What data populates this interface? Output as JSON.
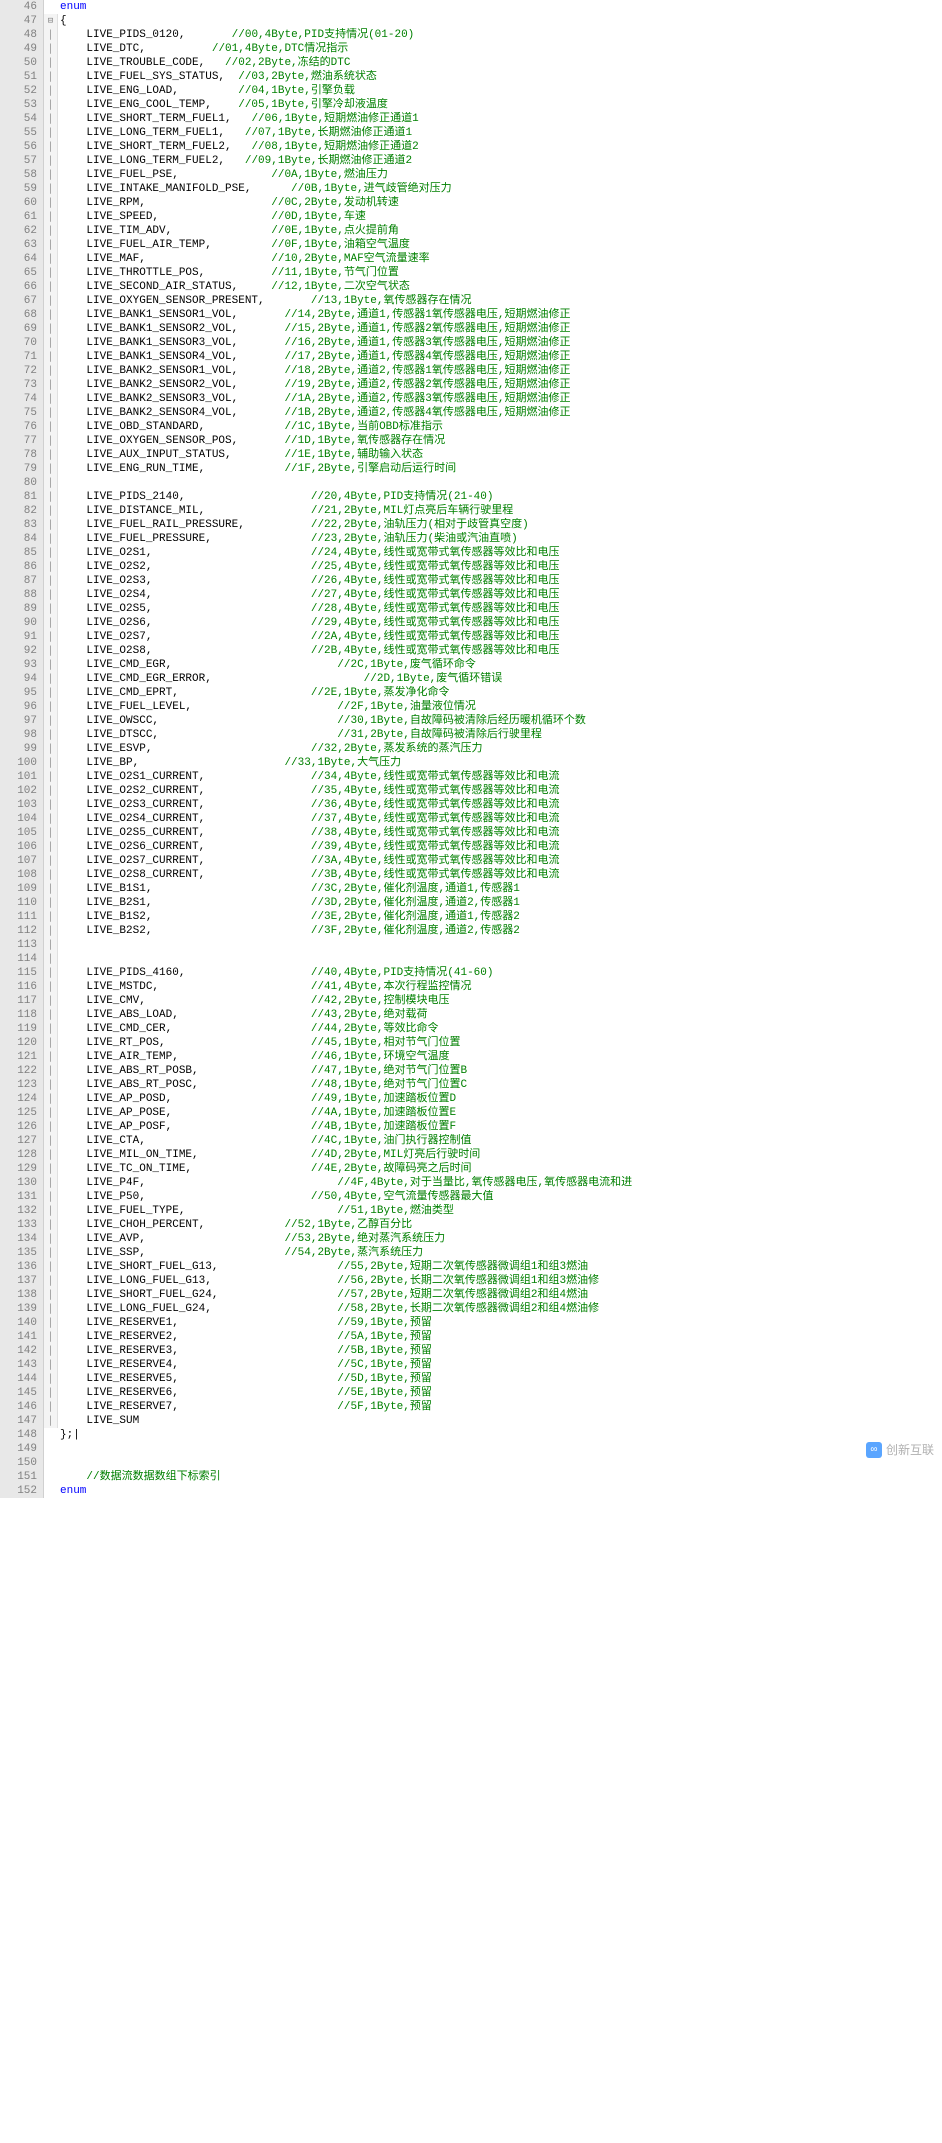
{
  "watermark": "创新互联",
  "bottom_comment": "//数据流数据数组下标索引",
  "lines": [
    {
      "n": 46,
      "fold": "",
      "type": "kw",
      "text": "enum"
    },
    {
      "n": 47,
      "fold": "⊟",
      "type": "punct",
      "text": "{"
    },
    {
      "n": 48,
      "fold": "|",
      "indent": "    ",
      "ident": "LIVE_PIDS_0120,",
      "pad": 7,
      "comment": "//00,4Byte,PID支持情况(01-20)"
    },
    {
      "n": 49,
      "fold": "|",
      "indent": "    ",
      "ident": "LIVE_DTC,",
      "pad": 10,
      "comment": "//01,4Byte,DTC情况指示"
    },
    {
      "n": 50,
      "fold": "|",
      "indent": "    ",
      "ident": "LIVE_TROUBLE_CODE,",
      "pad": 3,
      "comment": "//02,2Byte,冻结的DTC"
    },
    {
      "n": 51,
      "fold": "|",
      "indent": "    ",
      "ident": "LIVE_FUEL_SYS_STATUS,",
      "pad": 2,
      "comment": "//03,2Byte,燃油系统状态"
    },
    {
      "n": 52,
      "fold": "|",
      "indent": "    ",
      "ident": "LIVE_ENG_LOAD,",
      "pad": 9,
      "comment": "//04,1Byte,引擎负载"
    },
    {
      "n": 53,
      "fold": "|",
      "indent": "    ",
      "ident": "LIVE_ENG_COOL_TEMP,",
      "pad": 4,
      "comment": "//05,1Byte,引擎冷却液温度"
    },
    {
      "n": 54,
      "fold": "|",
      "indent": "    ",
      "ident": "LIVE_SHORT_TERM_FUEL1,",
      "pad": 3,
      "comment": "//06,1Byte,短期燃油修正通道1"
    },
    {
      "n": 55,
      "fold": "|",
      "indent": "    ",
      "ident": "LIVE_LONG_TERM_FUEL1,",
      "pad": 3,
      "comment": "//07,1Byte,长期燃油修正通道1"
    },
    {
      "n": 56,
      "fold": "|",
      "indent": "    ",
      "ident": "LIVE_SHORT_TERM_FUEL2,",
      "pad": 3,
      "comment": "//08,1Byte,短期燃油修正通道2"
    },
    {
      "n": 57,
      "fold": "|",
      "indent": "    ",
      "ident": "LIVE_LONG_TERM_FUEL2,",
      "pad": 3,
      "comment": "//09,1Byte,长期燃油修正通道2"
    },
    {
      "n": 58,
      "fold": "|",
      "indent": "    ",
      "ident": "LIVE_FUEL_PSE,",
      "pad": 14,
      "comment": "//0A,1Byte,燃油压力"
    },
    {
      "n": 59,
      "fold": "|",
      "indent": "    ",
      "ident": "LIVE_INTAKE_MANIFOLD_PSE,",
      "pad": 6,
      "comment": "//0B,1Byte,进气歧管绝对压力"
    },
    {
      "n": 60,
      "fold": "|",
      "indent": "    ",
      "ident": "LIVE_RPM,",
      "pad": 19,
      "comment": "//0C,2Byte,发动机转速"
    },
    {
      "n": 61,
      "fold": "|",
      "indent": "    ",
      "ident": "LIVE_SPEED,",
      "pad": 17,
      "comment": "//0D,1Byte,车速"
    },
    {
      "n": 62,
      "fold": "|",
      "indent": "    ",
      "ident": "LIVE_TIM_ADV,",
      "pad": 15,
      "comment": "//0E,1Byte,点火提前角"
    },
    {
      "n": 63,
      "fold": "|",
      "indent": "    ",
      "ident": "LIVE_FUEL_AIR_TEMP,",
      "pad": 9,
      "comment": "//0F,1Byte,油箱空气温度"
    },
    {
      "n": 64,
      "fold": "|",
      "indent": "    ",
      "ident": "LIVE_MAF,",
      "pad": 19,
      "comment": "//10,2Byte,MAF空气流量速率"
    },
    {
      "n": 65,
      "fold": "|",
      "indent": "    ",
      "ident": "LIVE_THROTTLE_POS,",
      "pad": 10,
      "comment": "//11,1Byte,节气门位置"
    },
    {
      "n": 66,
      "fold": "|",
      "indent": "    ",
      "ident": "LIVE_SECOND_AIR_STATUS,",
      "pad": 5,
      "comment": "//12,1Byte,二次空气状态"
    },
    {
      "n": 67,
      "fold": "|",
      "indent": "    ",
      "ident": "LIVE_OXYGEN_SENSOR_PRESENT,",
      "pad": 7,
      "comment": "//13,1Byte,氧传感器存在情况"
    },
    {
      "n": 68,
      "fold": "|",
      "indent": "    ",
      "ident": "LIVE_BANK1_SENSOR1_VOL,",
      "pad": 7,
      "comment": "//14,2Byte,通道1,传感器1氧传感器电压,短期燃油修正"
    },
    {
      "n": 69,
      "fold": "|",
      "indent": "    ",
      "ident": "LIVE_BANK1_SENSOR2_VOL,",
      "pad": 7,
      "comment": "//15,2Byte,通道1,传感器2氧传感器电压,短期燃油修正"
    },
    {
      "n": 70,
      "fold": "|",
      "indent": "    ",
      "ident": "LIVE_BANK1_SENSOR3_VOL,",
      "pad": 7,
      "comment": "//16,2Byte,通道1,传感器3氧传感器电压,短期燃油修正"
    },
    {
      "n": 71,
      "fold": "|",
      "indent": "    ",
      "ident": "LIVE_BANK1_SENSOR4_VOL,",
      "pad": 7,
      "comment": "//17,2Byte,通道1,传感器4氧传感器电压,短期燃油修正"
    },
    {
      "n": 72,
      "fold": "|",
      "indent": "    ",
      "ident": "LIVE_BANK2_SENSOR1_VOL,",
      "pad": 7,
      "comment": "//18,2Byte,通道2,传感器1氧传感器电压,短期燃油修正"
    },
    {
      "n": 73,
      "fold": "|",
      "indent": "    ",
      "ident": "LIVE_BANK2_SENSOR2_VOL,",
      "pad": 7,
      "comment": "//19,2Byte,通道2,传感器2氧传感器电压,短期燃油修正"
    },
    {
      "n": 74,
      "fold": "|",
      "indent": "    ",
      "ident": "LIVE_BANK2_SENSOR3_VOL,",
      "pad": 7,
      "comment": "//1A,2Byte,通道2,传感器3氧传感器电压,短期燃油修正"
    },
    {
      "n": 75,
      "fold": "|",
      "indent": "    ",
      "ident": "LIVE_BANK2_SENSOR4_VOL,",
      "pad": 7,
      "comment": "//1B,2Byte,通道2,传感器4氧传感器电压,短期燃油修正"
    },
    {
      "n": 76,
      "fold": "|",
      "indent": "    ",
      "ident": "LIVE_OBD_STANDARD,",
      "pad": 12,
      "comment": "//1C,1Byte,当前OBD标准指示"
    },
    {
      "n": 77,
      "fold": "|",
      "indent": "    ",
      "ident": "LIVE_OXYGEN_SENSOR_POS,",
      "pad": 7,
      "comment": "//1D,1Byte,氧传感器存在情况"
    },
    {
      "n": 78,
      "fold": "|",
      "indent": "    ",
      "ident": "LIVE_AUX_INPUT_STATUS,",
      "pad": 8,
      "comment": "//1E,1Byte,辅助输入状态"
    },
    {
      "n": 79,
      "fold": "|",
      "indent": "    ",
      "ident": "LIVE_ENG_RUN_TIME,",
      "pad": 12,
      "comment": "//1F,2Byte,引擎启动后运行时间"
    },
    {
      "n": 80,
      "fold": "|",
      "indent": "",
      "ident": "",
      "pad": 0,
      "comment": ""
    },
    {
      "n": 81,
      "fold": "|",
      "indent": "    ",
      "ident": "LIVE_PIDS_2140,",
      "pad": 19,
      "comment": "//20,4Byte,PID支持情况(21-40)"
    },
    {
      "n": 82,
      "fold": "|",
      "indent": "    ",
      "ident": "LIVE_DISTANCE_MIL,",
      "pad": 16,
      "comment": "//21,2Byte,MIL灯点亮后车辆行驶里程"
    },
    {
      "n": 83,
      "fold": "|",
      "indent": "    ",
      "ident": "LIVE_FUEL_RAIL_PRESSURE,",
      "pad": 10,
      "comment": "//22,2Byte,油轨压力(相对于歧管真空度)"
    },
    {
      "n": 84,
      "fold": "|",
      "indent": "    ",
      "ident": "LIVE_FUEL_PRESSURE,",
      "pad": 15,
      "comment": "//23,2Byte,油轨压力(柴油或汽油直喷)"
    },
    {
      "n": 85,
      "fold": "|",
      "indent": "    ",
      "ident": "LIVE_O2S1,",
      "pad": 24,
      "comment": "//24,4Byte,线性或宽带式氧传感器等效比和电压"
    },
    {
      "n": 86,
      "fold": "|",
      "indent": "    ",
      "ident": "LIVE_O2S2,",
      "pad": 24,
      "comment": "//25,4Byte,线性或宽带式氧传感器等效比和电压"
    },
    {
      "n": 87,
      "fold": "|",
      "indent": "    ",
      "ident": "LIVE_O2S3,",
      "pad": 24,
      "comment": "//26,4Byte,线性或宽带式氧传感器等效比和电压"
    },
    {
      "n": 88,
      "fold": "|",
      "indent": "    ",
      "ident": "LIVE_O2S4,",
      "pad": 24,
      "comment": "//27,4Byte,线性或宽带式氧传感器等效比和电压"
    },
    {
      "n": 89,
      "fold": "|",
      "indent": "    ",
      "ident": "LIVE_O2S5,",
      "pad": 24,
      "comment": "//28,4Byte,线性或宽带式氧传感器等效比和电压"
    },
    {
      "n": 90,
      "fold": "|",
      "indent": "    ",
      "ident": "LIVE_O2S6,",
      "pad": 24,
      "comment": "//29,4Byte,线性或宽带式氧传感器等效比和电压"
    },
    {
      "n": 91,
      "fold": "|",
      "indent": "    ",
      "ident": "LIVE_O2S7,",
      "pad": 24,
      "comment": "//2A,4Byte,线性或宽带式氧传感器等效比和电压"
    },
    {
      "n": 92,
      "fold": "|",
      "indent": "    ",
      "ident": "LIVE_O2S8,",
      "pad": 24,
      "comment": "//2B,4Byte,线性或宽带式氧传感器等效比和电压"
    },
    {
      "n": 93,
      "fold": "|",
      "indent": "    ",
      "ident": "LIVE_CMD_EGR,",
      "pad": 25,
      "comment": "//2C,1Byte,废气循环命令"
    },
    {
      "n": 94,
      "fold": "|",
      "indent": "    ",
      "ident": "LIVE_CMD_EGR_ERROR,",
      "pad": 23,
      "comment": "//2D,1Byte,废气循环错误"
    },
    {
      "n": 95,
      "fold": "|",
      "indent": "    ",
      "ident": "LIVE_CMD_EPRT,",
      "pad": 20,
      "comment": "//2E,1Byte,蒸发净化命令"
    },
    {
      "n": 96,
      "fold": "|",
      "indent": "    ",
      "ident": "LIVE_FUEL_LEVEL,",
      "pad": 22,
      "comment": "//2F,1Byte,油量液位情况"
    },
    {
      "n": 97,
      "fold": "|",
      "indent": "    ",
      "ident": "LIVE_OWSCC,",
      "pad": 27,
      "comment": "//30,1Byte,自故障码被清除后经历暖机循环个数"
    },
    {
      "n": 98,
      "fold": "|",
      "indent": "    ",
      "ident": "LIVE_DTSCC,",
      "pad": 27,
      "comment": "//31,2Byte,自故障码被清除后行驶里程"
    },
    {
      "n": 99,
      "fold": "|",
      "indent": "    ",
      "ident": "LIVE_ESVP,",
      "pad": 24,
      "comment": "//32,2Byte,蒸发系统的蒸汽压力"
    },
    {
      "n": 100,
      "fold": "|",
      "indent": "    ",
      "ident": "LIVE_BP,",
      "pad": 22,
      "comment": "//33,1Byte,大气压力"
    },
    {
      "n": 101,
      "fold": "|",
      "indent": "    ",
      "ident": "LIVE_O2S1_CURRENT,",
      "pad": 16,
      "comment": "//34,4Byte,线性或宽带式氧传感器等效比和电流"
    },
    {
      "n": 102,
      "fold": "|",
      "indent": "    ",
      "ident": "LIVE_O2S2_CURRENT,",
      "pad": 16,
      "comment": "//35,4Byte,线性或宽带式氧传感器等效比和电流"
    },
    {
      "n": 103,
      "fold": "|",
      "indent": "    ",
      "ident": "LIVE_O2S3_CURRENT,",
      "pad": 16,
      "comment": "//36,4Byte,线性或宽带式氧传感器等效比和电流"
    },
    {
      "n": 104,
      "fold": "|",
      "indent": "    ",
      "ident": "LIVE_O2S4_CURRENT,",
      "pad": 16,
      "comment": "//37,4Byte,线性或宽带式氧传感器等效比和电流"
    },
    {
      "n": 105,
      "fold": "|",
      "indent": "    ",
      "ident": "LIVE_O2S5_CURRENT,",
      "pad": 16,
      "comment": "//38,4Byte,线性或宽带式氧传感器等效比和电流"
    },
    {
      "n": 106,
      "fold": "|",
      "indent": "    ",
      "ident": "LIVE_O2S6_CURRENT,",
      "pad": 16,
      "comment": "//39,4Byte,线性或宽带式氧传感器等效比和电流"
    },
    {
      "n": 107,
      "fold": "|",
      "indent": "    ",
      "ident": "LIVE_O2S7_CURRENT,",
      "pad": 16,
      "comment": "//3A,4Byte,线性或宽带式氧传感器等效比和电流"
    },
    {
      "n": 108,
      "fold": "|",
      "indent": "    ",
      "ident": "LIVE_O2S8_CURRENT,",
      "pad": 16,
      "comment": "//3B,4Byte,线性或宽带式氧传感器等效比和电流"
    },
    {
      "n": 109,
      "fold": "|",
      "indent": "    ",
      "ident": "LIVE_B1S1,",
      "pad": 24,
      "comment": "//3C,2Byte,催化剂温度,通道1,传感器1"
    },
    {
      "n": 110,
      "fold": "|",
      "indent": "    ",
      "ident": "LIVE_B2S1,",
      "pad": 24,
      "comment": "//3D,2Byte,催化剂温度,通道2,传感器1"
    },
    {
      "n": 111,
      "fold": "|",
      "indent": "    ",
      "ident": "LIVE_B1S2,",
      "pad": 24,
      "comment": "//3E,2Byte,催化剂温度,通道1,传感器2"
    },
    {
      "n": 112,
      "fold": "|",
      "indent": "    ",
      "ident": "LIVE_B2S2,",
      "pad": 24,
      "comment": "//3F,2Byte,催化剂温度,通道2,传感器2"
    },
    {
      "n": 113,
      "fold": "|",
      "indent": "",
      "ident": "",
      "pad": 0,
      "comment": ""
    },
    {
      "n": 114,
      "fold": "|",
      "indent": "",
      "ident": "",
      "pad": 0,
      "comment": ""
    },
    {
      "n": 115,
      "fold": "|",
      "indent": "    ",
      "ident": "LIVE_PIDS_4160,",
      "pad": 19,
      "comment": "//40,4Byte,PID支持情况(41-60)"
    },
    {
      "n": 116,
      "fold": "|",
      "indent": "    ",
      "ident": "LIVE_MSTDC,",
      "pad": 23,
      "comment": "//41,4Byte,本次行程监控情况"
    },
    {
      "n": 117,
      "fold": "|",
      "indent": "    ",
      "ident": "LIVE_CMV,",
      "pad": 25,
      "comment": "//42,2Byte,控制模块电压"
    },
    {
      "n": 118,
      "fold": "|",
      "indent": "    ",
      "ident": "LIVE_ABS_LOAD,",
      "pad": 20,
      "comment": "//43,2Byte,绝对载荷"
    },
    {
      "n": 119,
      "fold": "|",
      "indent": "    ",
      "ident": "LIVE_CMD_CER,",
      "pad": 21,
      "comment": "//44,2Byte,等效比命令"
    },
    {
      "n": 120,
      "fold": "|",
      "indent": "    ",
      "ident": "LIVE_RT_POS,",
      "pad": 22,
      "comment": "//45,1Byte,相对节气门位置"
    },
    {
      "n": 121,
      "fold": "|",
      "indent": "    ",
      "ident": "LIVE_AIR_TEMP,",
      "pad": 20,
      "comment": "//46,1Byte,环境空气温度"
    },
    {
      "n": 122,
      "fold": "|",
      "indent": "    ",
      "ident": "LIVE_ABS_RT_POSB,",
      "pad": 17,
      "comment": "//47,1Byte,绝对节气门位置B"
    },
    {
      "n": 123,
      "fold": "|",
      "indent": "    ",
      "ident": "LIVE_ABS_RT_POSC,",
      "pad": 17,
      "comment": "//48,1Byte,绝对节气门位置C"
    },
    {
      "n": 124,
      "fold": "|",
      "indent": "    ",
      "ident": "LIVE_AP_POSD,",
      "pad": 21,
      "comment": "//49,1Byte,加速踏板位置D"
    },
    {
      "n": 125,
      "fold": "|",
      "indent": "    ",
      "ident": "LIVE_AP_POSE,",
      "pad": 21,
      "comment": "//4A,1Byte,加速踏板位置E"
    },
    {
      "n": 126,
      "fold": "|",
      "indent": "    ",
      "ident": "LIVE_AP_POSF,",
      "pad": 21,
      "comment": "//4B,1Byte,加速踏板位置F"
    },
    {
      "n": 127,
      "fold": "|",
      "indent": "    ",
      "ident": "LIVE_CTA,",
      "pad": 25,
      "comment": "//4C,1Byte,油门执行器控制值"
    },
    {
      "n": 128,
      "fold": "|",
      "indent": "    ",
      "ident": "LIVE_MIL_ON_TIME,",
      "pad": 17,
      "comment": "//4D,2Byte,MIL灯亮后行驶时间"
    },
    {
      "n": 129,
      "fold": "|",
      "indent": "    ",
      "ident": "LIVE_TC_ON_TIME,",
      "pad": 18,
      "comment": "//4E,2Byte,故障码亮之后时间"
    },
    {
      "n": 130,
      "fold": "|",
      "indent": "    ",
      "ident": "LIVE_P4F,",
      "pad": 29,
      "comment": "//4F,4Byte,对于当量比,氧传感器电压,氧传感器电流和进"
    },
    {
      "n": 131,
      "fold": "|",
      "indent": "    ",
      "ident": "LIVE_P50,",
      "pad": 25,
      "comment": "//50,4Byte,空气流量传感器最大值"
    },
    {
      "n": 132,
      "fold": "|",
      "indent": "    ",
      "ident": "LIVE_FUEL_TYPE,",
      "pad": 23,
      "comment": "//51,1Byte,燃油类型"
    },
    {
      "n": 133,
      "fold": "|",
      "indent": "    ",
      "ident": "LIVE_CHOH_PERCENT,",
      "pad": 12,
      "comment": "//52,1Byte,乙醇百分比"
    },
    {
      "n": 134,
      "fold": "|",
      "indent": "    ",
      "ident": "LIVE_AVP,",
      "pad": 21,
      "comment": "//53,2Byte,绝对蒸汽系统压力"
    },
    {
      "n": 135,
      "fold": "|",
      "indent": "    ",
      "ident": "LIVE_SSP,",
      "pad": 21,
      "comment": "//54,2Byte,蒸汽系统压力"
    },
    {
      "n": 136,
      "fold": "|",
      "indent": "    ",
      "ident": "LIVE_SHORT_FUEL_G13,",
      "pad": 18,
      "comment": "//55,2Byte,短期二次氧传感器微调组1和组3燃油"
    },
    {
      "n": 137,
      "fold": "|",
      "indent": "    ",
      "ident": "LIVE_LONG_FUEL_G13,",
      "pad": 19,
      "comment": "//56,2Byte,长期二次氧传感器微调组1和组3燃油修"
    },
    {
      "n": 138,
      "fold": "|",
      "indent": "    ",
      "ident": "LIVE_SHORT_FUEL_G24,",
      "pad": 18,
      "comment": "//57,2Byte,短期二次氧传感器微调组2和组4燃油"
    },
    {
      "n": 139,
      "fold": "|",
      "indent": "    ",
      "ident": "LIVE_LONG_FUEL_G24,",
      "pad": 19,
      "comment": "//58,2Byte,长期二次氧传感器微调组2和组4燃油修"
    },
    {
      "n": 140,
      "fold": "|",
      "indent": "    ",
      "ident": "LIVE_RESERVE1,",
      "pad": 24,
      "comment": "//59,1Byte,预留"
    },
    {
      "n": 141,
      "fold": "|",
      "indent": "    ",
      "ident": "LIVE_RESERVE2,",
      "pad": 24,
      "comment": "//5A,1Byte,预留"
    },
    {
      "n": 142,
      "fold": "|",
      "indent": "    ",
      "ident": "LIVE_RESERVE3,",
      "pad": 24,
      "comment": "//5B,1Byte,预留"
    },
    {
      "n": 143,
      "fold": "|",
      "indent": "    ",
      "ident": "LIVE_RESERVE4,",
      "pad": 24,
      "comment": "//5C,1Byte,预留"
    },
    {
      "n": 144,
      "fold": "|",
      "indent": "    ",
      "ident": "LIVE_RESERVE5,",
      "pad": 24,
      "comment": "//5D,1Byte,预留"
    },
    {
      "n": 145,
      "fold": "|",
      "indent": "    ",
      "ident": "LIVE_RESERVE6,",
      "pad": 24,
      "comment": "//5E,1Byte,预留"
    },
    {
      "n": 146,
      "fold": "|",
      "indent": "    ",
      "ident": "LIVE_RESERVE7,",
      "pad": 24,
      "comment": "//5F,1Byte,预留"
    },
    {
      "n": 147,
      "fold": "|",
      "indent": "    ",
      "ident": "LIVE_SUM",
      "pad": 0,
      "comment": ""
    },
    {
      "n": 148,
      "fold": "",
      "type": "punct",
      "text": "};",
      "cursor": true
    },
    {
      "n": 149,
      "fold": "",
      "indent": "",
      "ident": "",
      "pad": 0,
      "comment": ""
    },
    {
      "n": 150,
      "fold": "",
      "indent": "",
      "ident": "",
      "pad": 0,
      "comment": ""
    },
    {
      "n": 151,
      "fold": "",
      "indent": "    ",
      "ident": "",
      "pad": 0,
      "comment_only": true,
      "comment": "//数据流数据数组下标索引"
    },
    {
      "n": 152,
      "fold": "",
      "type": "kw",
      "text": "enum"
    }
  ]
}
